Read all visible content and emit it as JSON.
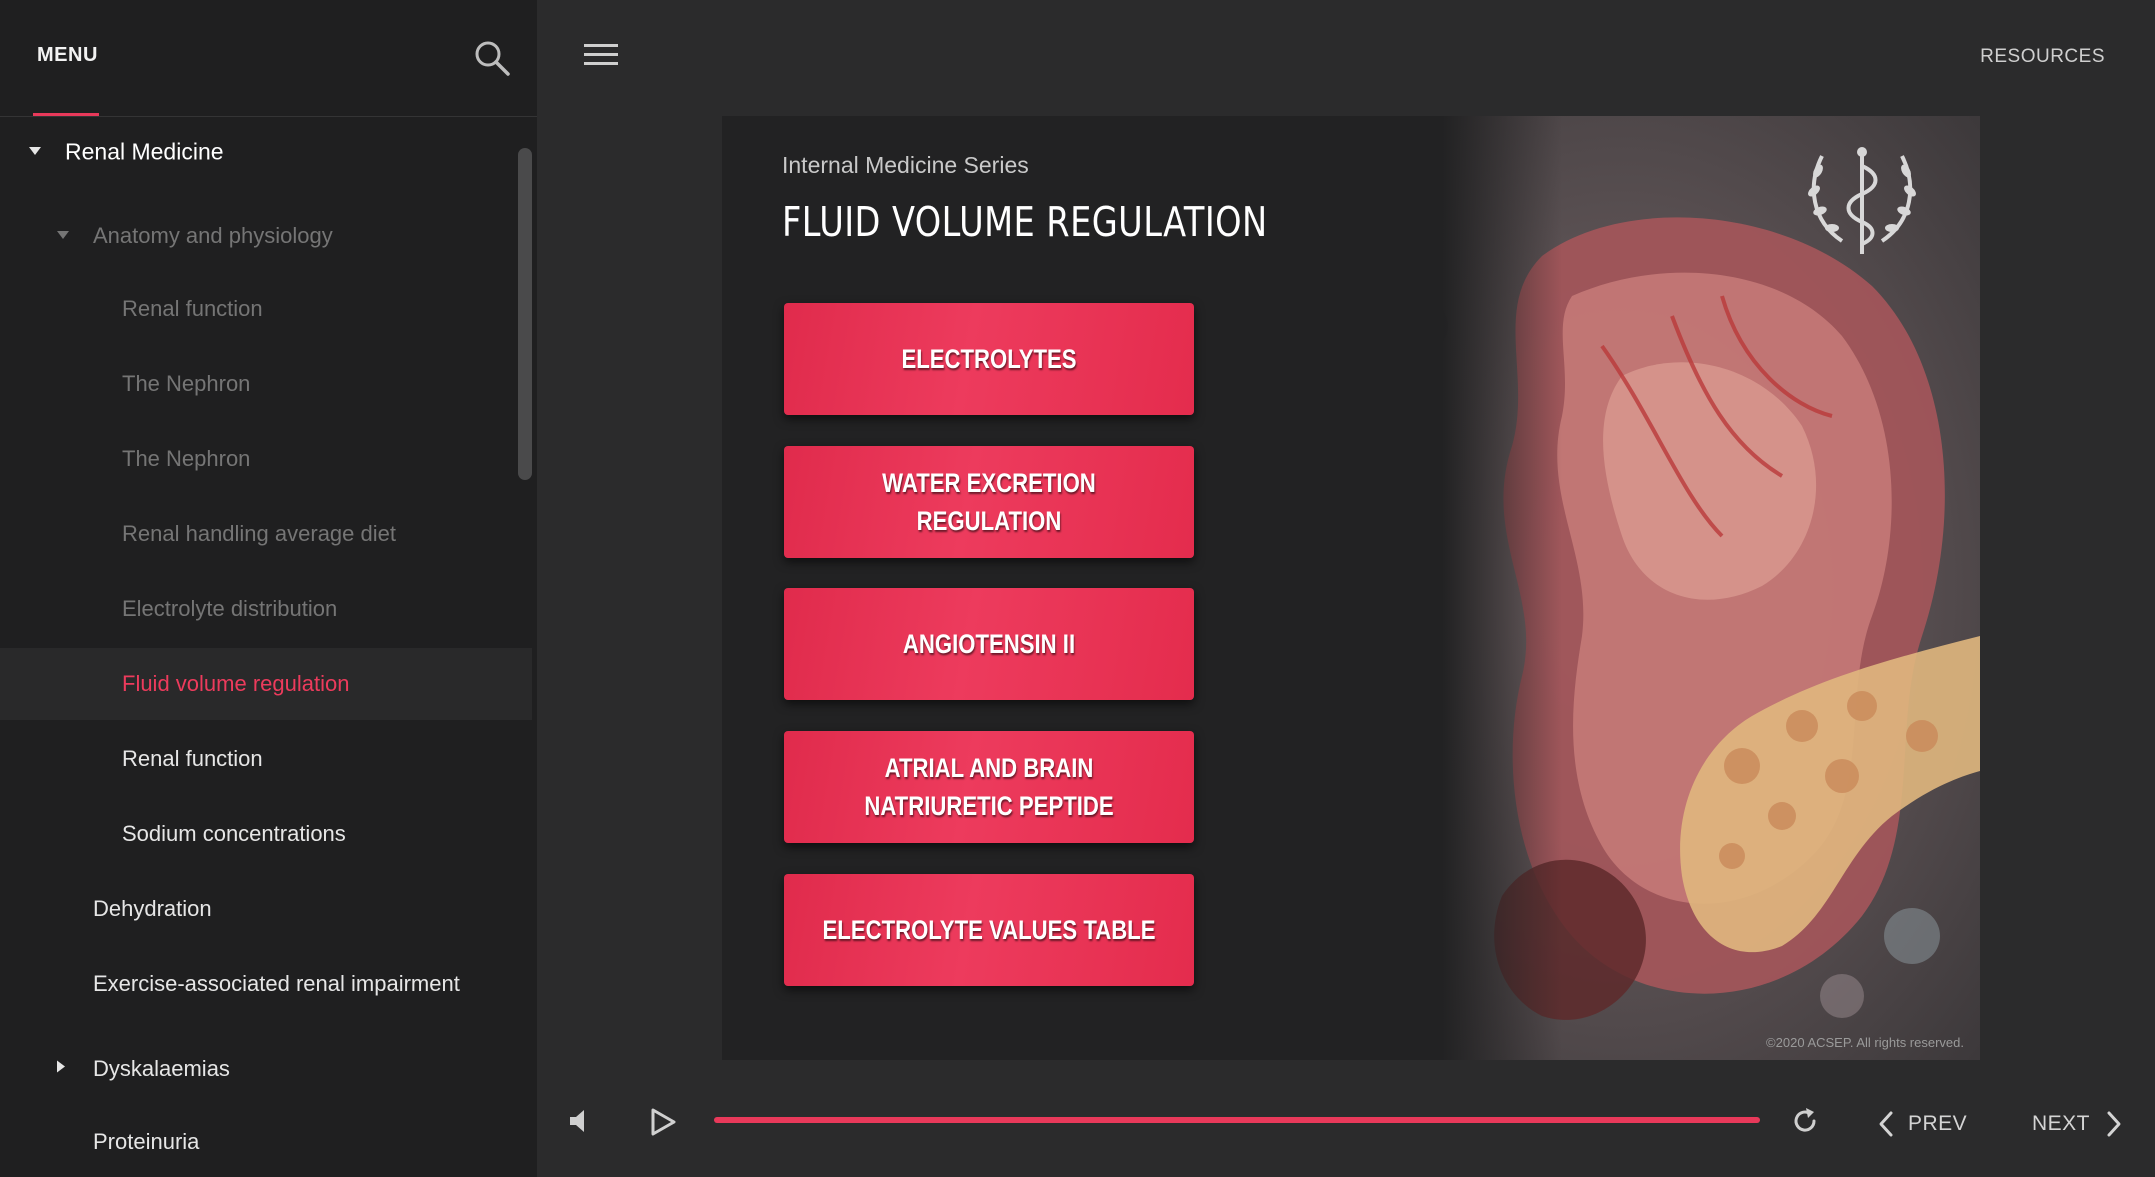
{
  "sidebar": {
    "title": "MENU",
    "search_icon": "search-icon",
    "items": [
      {
        "label": "Renal Medicine",
        "level": 0,
        "caret": "down",
        "dim": false,
        "active": false
      },
      {
        "label": "Anatomy and physiology",
        "level": 1,
        "caret": "down",
        "dim": true,
        "active": false
      },
      {
        "label": "Renal function",
        "level": 2,
        "caret": "",
        "dim": true,
        "active": false
      },
      {
        "label": "The Nephron",
        "level": 2,
        "caret": "",
        "dim": true,
        "active": false
      },
      {
        "label": "The Nephron",
        "level": 2,
        "caret": "",
        "dim": true,
        "active": false
      },
      {
        "label": "Renal handling average diet",
        "level": 2,
        "caret": "",
        "dim": true,
        "active": false
      },
      {
        "label": "Electrolyte distribution",
        "level": 2,
        "caret": "",
        "dim": true,
        "active": false
      },
      {
        "label": "Fluid volume regulation",
        "level": 2,
        "caret": "",
        "dim": false,
        "active": true
      },
      {
        "label": "Renal function",
        "level": 2,
        "caret": "",
        "dim": false,
        "active": false
      },
      {
        "label": "Sodium concentrations",
        "level": 2,
        "caret": "",
        "dim": false,
        "active": false
      },
      {
        "label": "Dehydration",
        "level": 1,
        "caret": "",
        "dim": false,
        "active": false
      },
      {
        "label": "Exercise-associated renal impairment",
        "level": 1,
        "caret": "",
        "dim": false,
        "active": false
      },
      {
        "label": "Dyskalaemias",
        "level": 1,
        "caret": "right",
        "dim": false,
        "active": false
      },
      {
        "label": "Proteinuria",
        "level": 1,
        "caret": "",
        "dim": false,
        "active": false
      }
    ]
  },
  "topbar": {
    "menu_icon": "hamburger-icon",
    "resources_label": "RESOURCES"
  },
  "slide": {
    "series": "Internal Medicine Series",
    "title": "FLUID VOLUME REGULATION",
    "buttons": [
      {
        "label": "ELECTROLYTES"
      },
      {
        "label": "WATER EXCRETION REGULATION"
      },
      {
        "label": "ANGIOTENSIN II"
      },
      {
        "label": "ATRIAL AND BRAIN NATRIURETIC PEPTIDE"
      },
      {
        "label": "ELECTROLYTE VALUES TABLE"
      }
    ],
    "logo": "caduceus-laurel-icon",
    "copyright": "©2020 ACSEP. All rights reserved.",
    "image": "kidney-illustration",
    "accent_color": "#e8395a"
  },
  "player": {
    "mute_icon": "speaker-icon",
    "play_icon": "play-icon",
    "progress": 1.0,
    "replay_icon": "replay-icon",
    "prev_label": "PREV",
    "next_label": "NEXT"
  }
}
